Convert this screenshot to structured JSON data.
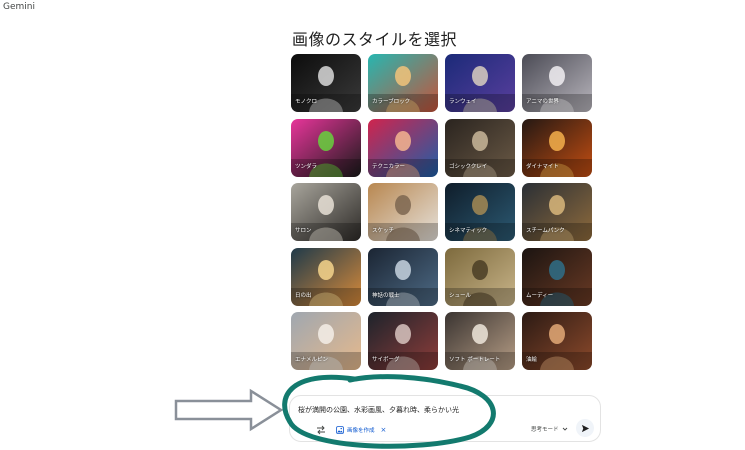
{
  "app": {
    "title": "Gemini"
  },
  "gallery": {
    "heading": "画像のスタイルを選択",
    "styles": [
      {
        "label": "モノクロ",
        "colors": [
          "#0c0c0c",
          "#3a3a3a",
          "#d9d9d9"
        ]
      },
      {
        "label": "カラーブロック",
        "colors": [
          "#27b6b0",
          "#c6533a",
          "#f2c37a"
        ]
      },
      {
        "label": "ランウェイ",
        "colors": [
          "#1b2a78",
          "#5a3f9e",
          "#d9cfc0"
        ]
      },
      {
        "label": "アニマの世界",
        "colors": [
          "#4b4b55",
          "#b9b6bd",
          "#f1eef2"
        ]
      },
      {
        "label": "ツンダラ",
        "colors": [
          "#e8359a",
          "#1a1a1a",
          "#67d13d"
        ]
      },
      {
        "label": "テクニカラー",
        "colors": [
          "#d0244d",
          "#1d5fa8",
          "#f5b58f"
        ]
      },
      {
        "label": "ゴシッククレイ",
        "colors": [
          "#2a241f",
          "#6b5a46",
          "#c9b79a"
        ]
      },
      {
        "label": "ダイナマイト",
        "colors": [
          "#241813",
          "#c44e12",
          "#f4b04c"
        ]
      },
      {
        "label": "サロン",
        "colors": [
          "#a8a59c",
          "#2d2a27",
          "#e8e1d6"
        ]
      },
      {
        "label": "スケッチ",
        "colors": [
          "#b88750",
          "#e6e2dc",
          "#7d6650"
        ]
      },
      {
        "label": "シネマティック",
        "colors": [
          "#0f1d2a",
          "#2c5a73",
          "#a48954"
        ]
      },
      {
        "label": "スチームパンク",
        "colors": [
          "#2a2f35",
          "#8f6b3c",
          "#d9b77b"
        ]
      },
      {
        "label": "日の出",
        "colors": [
          "#1f3a4a",
          "#d98b3a",
          "#f6d58c"
        ]
      },
      {
        "label": "神話の戦士",
        "colors": [
          "#1b2533",
          "#4e6b86",
          "#c7d3df"
        ]
      },
      {
        "label": "シュール",
        "colors": [
          "#7d6a3d",
          "#c9b58a",
          "#4a3d24"
        ]
      },
      {
        "label": "ムーディー",
        "colors": [
          "#1b1411",
          "#6a3a24",
          "#2f6f88"
        ]
      },
      {
        "label": "エナメルピン",
        "colors": [
          "#9fa7b0",
          "#e6b98c",
          "#f4efe8"
        ]
      },
      {
        "label": "サイボーグ",
        "colors": [
          "#1d232b",
          "#8f3d3a",
          "#d8c4c0"
        ]
      },
      {
        "label": "ソフト ポートレート",
        "colors": [
          "#3a3431",
          "#b79e86",
          "#efe6db"
        ]
      },
      {
        "label": "油絵",
        "colors": [
          "#2b1a14",
          "#8d4a2b",
          "#e3a977"
        ]
      }
    ]
  },
  "prompt": {
    "text": "桜が満開の公園、水彩画風、夕暮れ時、柔らかい光",
    "create_image_chip": "画像を作成",
    "chip_close": "×",
    "mode": "思考モード"
  },
  "annotation": {
    "arrow_color": "#8a9099",
    "ellipse_color": "#137a6e"
  }
}
